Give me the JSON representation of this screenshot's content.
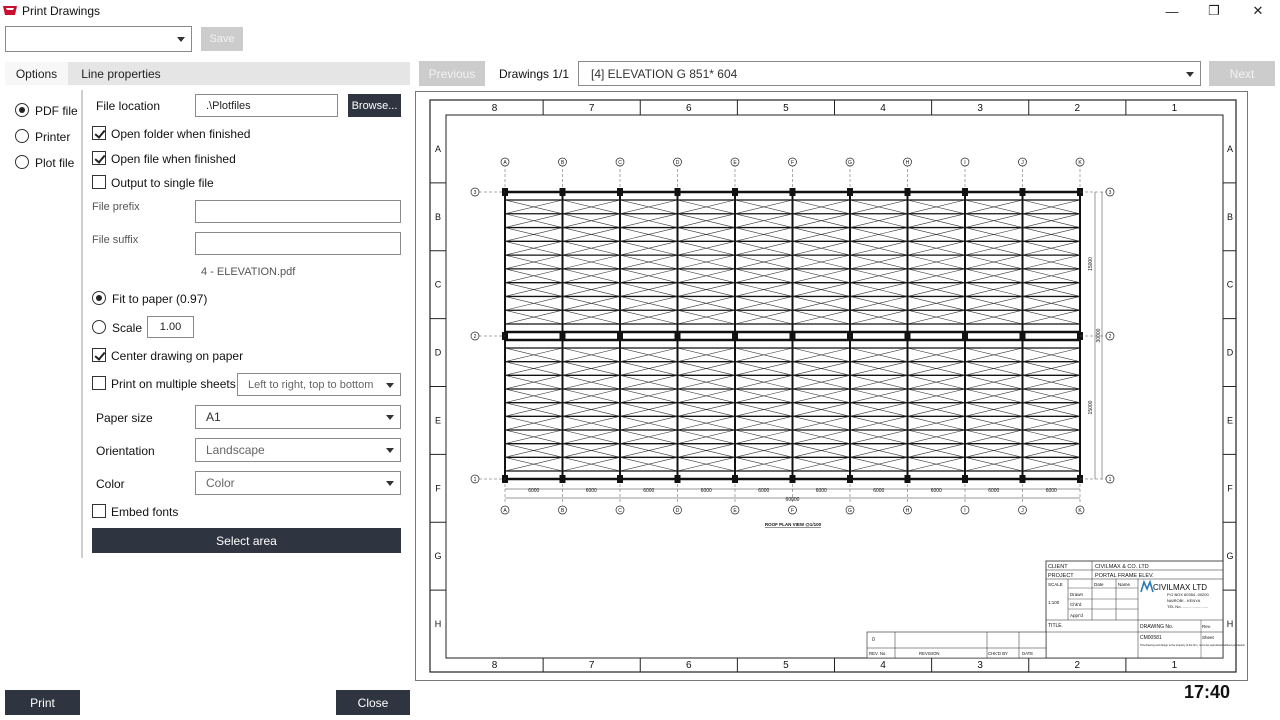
{
  "window": {
    "title": "Print Drawings",
    "minimize_glyph": "—",
    "maximize_glyph": "❐",
    "close_glyph": "✕"
  },
  "toolbar": {
    "preset_value": "",
    "save_label": "Save"
  },
  "tabs": [
    {
      "label": "Options"
    },
    {
      "label": "Line properties"
    }
  ],
  "output": {
    "pdf_label": "PDF file",
    "printer_label": "Printer",
    "plot_label": "Plot file",
    "selected": "PDF file"
  },
  "options": {
    "file_location_label": "File location",
    "file_location_value": ".\\Plotfiles",
    "browse_label": "Browse...",
    "open_folder_label": "Open folder when finished",
    "open_folder_checked": true,
    "open_file_label": "Open file when finished",
    "open_file_checked": true,
    "single_file_label": "Output to single file",
    "single_file_checked": false,
    "file_prefix_label": "File prefix",
    "file_prefix_value": "",
    "file_suffix_label": "File suffix",
    "file_suffix_value": "",
    "filename_preview": "4 - ELEVATION.pdf",
    "fit_label": "Fit to paper (0.97)",
    "scale_label": "Scale",
    "scale_value": "1.00",
    "center_label": "Center drawing on paper",
    "center_checked": true,
    "multi_label": "Print on multiple sheets",
    "multi_checked": false,
    "multi_order": "Left to right, top to bottom",
    "paper_size_label": "Paper size",
    "paper_size_value": "A1",
    "orientation_label": "Orientation",
    "orientation_value": "Landscape",
    "color_label": "Color",
    "color_value": "Color",
    "embed_label": "Embed fonts",
    "embed_checked": false,
    "select_area_label": "Select area"
  },
  "preview_nav": {
    "previous_label": "Previous",
    "counter": "Drawings 1/1",
    "drawing_value": "[4] ELEVATION G  851* 604",
    "next_label": "Next"
  },
  "footer": {
    "print_label": "Print",
    "close_label": "Close",
    "clock": "17:40"
  },
  "drawing": {
    "columns": [
      "8",
      "7",
      "6",
      "5",
      "4",
      "3",
      "2",
      "1"
    ],
    "rows": [
      "A",
      "B",
      "C",
      "D",
      "E",
      "F",
      "G",
      "H"
    ],
    "grid_letters": [
      "A",
      "B",
      "C",
      "D",
      "E",
      "F",
      "G",
      "H",
      "I",
      "J",
      "K"
    ],
    "grid_numbers": [
      "3",
      "2",
      "1"
    ],
    "bay_dims": [
      "6000",
      "6000",
      "6000",
      "6000",
      "6000",
      "6000",
      "6000",
      "6000",
      "6000",
      "6000"
    ],
    "total_dim": "60000",
    "side_dims": [
      "15000",
      "30000",
      "15000"
    ],
    "plan_title": "ROOF PLAN VIEW @1/100",
    "title_block": {
      "client_label": "CLIENT",
      "client": "CIVILMAX & CO. LTD",
      "project_label": "PROJECT",
      "project": "PORTAL FRAME ELEV.",
      "scale_label": "SCALE",
      "date_label": "Date",
      "name_label": "Name",
      "scale": "1:100",
      "drawn": "Drawn",
      "chkd": "Chk'd",
      "apprd": "Appr'd",
      "company": "CIVILMAX LTD",
      "address1": "P.O BOX 60354 -00200",
      "address2": "NAIROBI - KENYA",
      "tel": "TEL No.........................",
      "title_label": "TITLE.",
      "drawing_no_label": "DRAWING No.",
      "rev_label": "Rev.",
      "drawing_no": "CM00581",
      "sheet_label": "Sheet",
      "note": "This drawing and design is the property of the firm, not to be reproduced without permission",
      "rev_no": "0",
      "rev_no_label": "REV. No.",
      "revision_label": "REVISION",
      "chkd_by_label": "CHK'D BY",
      "date2_label": "DATE"
    }
  }
}
